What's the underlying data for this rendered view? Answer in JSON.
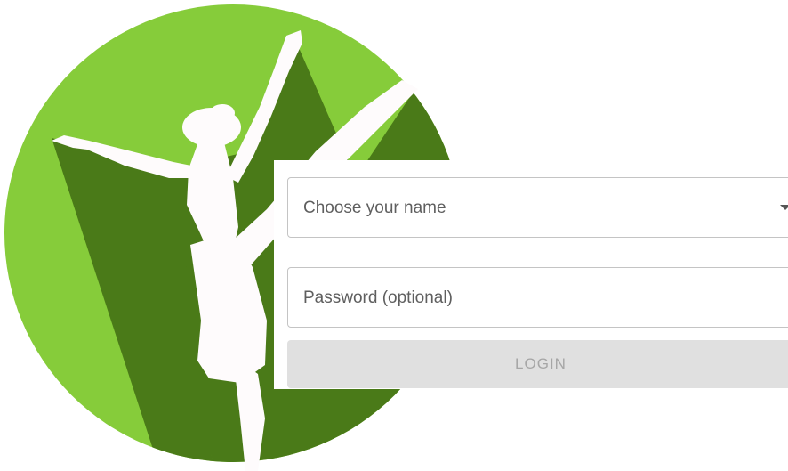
{
  "logo": {
    "icon": "ballerina-logo-icon",
    "colors": {
      "circle": "#86cc3a",
      "mountain": "#4a7a18",
      "silhouette": "#fefbfc"
    }
  },
  "login": {
    "name_select": {
      "placeholder": "Choose your name",
      "icon": "chevron-down-icon"
    },
    "password_field": {
      "placeholder": "Password (optional)",
      "value": ""
    },
    "login_button": {
      "label": "LOGIN",
      "disabled": true
    }
  }
}
